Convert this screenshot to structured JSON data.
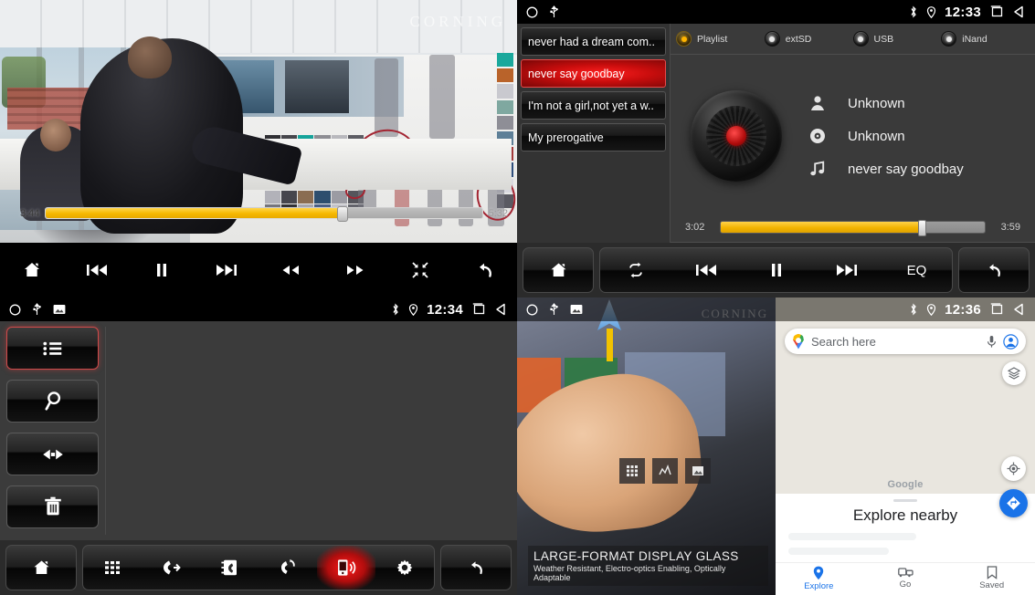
{
  "panels": {
    "video_player": {
      "name": "video-player",
      "watermark": "CORNING",
      "seek": {
        "current": "3:44",
        "total": "5:32",
        "progress_percent": 68
      },
      "controls": [
        {
          "name": "home",
          "icon": "home-icon",
          "glyph": "⌂"
        },
        {
          "name": "previous",
          "icon": "previous-track-icon",
          "glyph": "⏮"
        },
        {
          "name": "pause",
          "icon": "pause-icon",
          "glyph": "❘❘"
        },
        {
          "name": "next",
          "icon": "next-track-icon",
          "glyph": "⏭"
        },
        {
          "name": "rewind",
          "icon": "rewind-icon",
          "glyph": "⏪"
        },
        {
          "name": "fast-forward",
          "icon": "fast-forward-icon",
          "glyph": "⏩"
        },
        {
          "name": "exit-fullscreen",
          "icon": "shrink-icon",
          "glyph": "⤢"
        },
        {
          "name": "back",
          "icon": "back-arrow-icon",
          "glyph": "↩"
        }
      ]
    },
    "music_player": {
      "name": "music-player",
      "statusbar": {
        "time": "12:33",
        "icons": [
          "circle-icon",
          "usb-icon",
          "bluetooth-icon",
          "location-icon",
          "recents-icon",
          "back-icon"
        ]
      },
      "playlist": [
        {
          "label": "never had a dream com..",
          "selected": false
        },
        {
          "label": "never say goodbay",
          "selected": true
        },
        {
          "label": "I'm not a girl,not yet a w..",
          "selected": false
        },
        {
          "label": "My prerogative",
          "selected": false
        }
      ],
      "sources": [
        {
          "label": "Playlist",
          "selected": true
        },
        {
          "label": "extSD",
          "selected": false
        },
        {
          "label": "USB",
          "selected": false
        },
        {
          "label": "iNand",
          "selected": false
        }
      ],
      "metadata": [
        {
          "icon": "artist-icon",
          "glyph": "♟",
          "value": "Unknown"
        },
        {
          "icon": "album-icon",
          "glyph": "◉",
          "value": "Unknown"
        },
        {
          "icon": "track-icon",
          "glyph": "♫",
          "value": "never say goodbay"
        }
      ],
      "seek": {
        "current": "3:02",
        "total": "3:59",
        "progress_percent": 76
      },
      "controls": {
        "home": {
          "label": "",
          "icon": "home-icon",
          "glyph": "⌂"
        },
        "items": [
          {
            "name": "repeat",
            "label": "",
            "icon": "repeat-icon",
            "glyph": "↺"
          },
          {
            "name": "previous",
            "label": "",
            "icon": "previous-track-icon",
            "glyph": "⏮"
          },
          {
            "name": "pause",
            "label": "",
            "icon": "pause-icon",
            "glyph": "❘❘"
          },
          {
            "name": "next",
            "label": "",
            "icon": "next-track-icon",
            "glyph": "⏭"
          },
          {
            "name": "equalizer",
            "label": "EQ",
            "icon": "eq-label",
            "glyph": ""
          }
        ],
        "back": {
          "label": "",
          "icon": "back-arrow-icon",
          "glyph": "↩"
        }
      }
    },
    "phone": {
      "name": "bluetooth-phone",
      "statusbar": {
        "time": "12:34",
        "icons": [
          "circle-icon",
          "usb-icon",
          "image-icon",
          "bluetooth-icon",
          "location-icon",
          "recents-icon",
          "back-icon"
        ]
      },
      "side_buttons": [
        {
          "name": "contact-list",
          "icon": "list-icon",
          "glyph": "☰",
          "selected": true
        },
        {
          "name": "search-contacts",
          "icon": "search-icon",
          "glyph": "⌕",
          "selected": false
        },
        {
          "name": "sync-contacts",
          "icon": "sync-plug-icon",
          "glyph": "◀▶",
          "selected": false
        },
        {
          "name": "delete-contacts",
          "icon": "trash-icon",
          "glyph": "🗑",
          "selected": false
        }
      ],
      "toolbar": {
        "home": {
          "icon": "home-icon",
          "glyph": "⌂"
        },
        "items": [
          {
            "name": "dialpad",
            "icon": "dialpad-icon",
            "glyph": "∷",
            "active": false
          },
          {
            "name": "answer-call",
            "icon": "call-answer-icon",
            "glyph": "☎",
            "active": false
          },
          {
            "name": "contacts",
            "icon": "contacts-book-icon",
            "glyph": "☷",
            "active": false
          },
          {
            "name": "call-history",
            "icon": "call-history-icon",
            "glyph": "↻",
            "active": false
          },
          {
            "name": "bluetooth-phone",
            "icon": "mobile-signal-icon",
            "glyph": "℡",
            "active": true
          },
          {
            "name": "settings",
            "icon": "gear-icon",
            "glyph": "⚙",
            "active": false
          }
        ],
        "back": {
          "icon": "back-arrow-icon",
          "glyph": "↩"
        }
      }
    },
    "video_mirror": {
      "name": "screen-mirror-video",
      "statusbar": {
        "icons": [
          "circle-icon",
          "usb-icon",
          "image-icon"
        ]
      },
      "watermark": "CORNING",
      "caption_title": "LARGE-FORMAT DISPLAY GLASS",
      "caption_sub": "Weather Resistant, Electro-optics Enabling, Optically Adaptable",
      "overlay_icons": [
        "grid-icon",
        "chart-icon",
        "picture-icon"
      ]
    },
    "maps": {
      "name": "google-maps",
      "statusbar": {
        "time": "12:36",
        "icons": [
          "bluetooth-icon",
          "location-icon",
          "recents-icon",
          "back-icon"
        ]
      },
      "search": {
        "placeholder": "Search here",
        "value": ""
      },
      "buttons": {
        "voice": "mic-icon",
        "account": "account-avatar-icon",
        "layers": "layers-icon",
        "locate": "my-location-icon",
        "directions": "directions-icon"
      },
      "watermark": "Google",
      "sheet_title": "Explore nearby",
      "nav": [
        {
          "label": "Explore",
          "icon": "place-pin-icon",
          "glyph": "◉",
          "active": true
        },
        {
          "label": "Go",
          "icon": "commute-icon",
          "glyph": "▭",
          "active": false
        },
        {
          "label": "Saved",
          "icon": "bookmark-icon",
          "glyph": "☐",
          "active": false
        }
      ]
    }
  },
  "colors": {
    "accent_yellow": "#f2b300",
    "accent_red": "#cc0f0f",
    "google_blue": "#1a73e8",
    "panel_gray": "#3a3a3a",
    "status_black": "#000000"
  }
}
